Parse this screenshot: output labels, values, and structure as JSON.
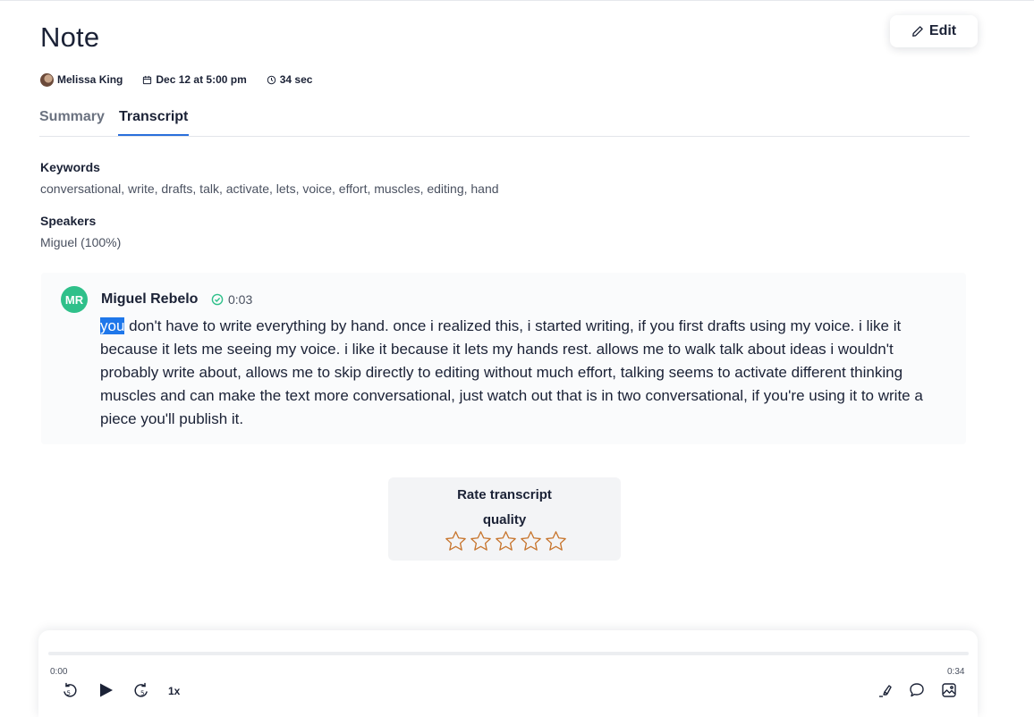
{
  "page": {
    "title": "Note"
  },
  "actions": {
    "edit_label": "Edit"
  },
  "meta": {
    "author": "Melissa King",
    "date": "Dec 12 at 5:00 pm",
    "duration": "34 sec"
  },
  "tabs": [
    {
      "label": "Summary",
      "active": false
    },
    {
      "label": "Transcript",
      "active": true
    }
  ],
  "keywords": {
    "label": "Keywords",
    "value": "conversational, write, drafts, talk, activate, lets, voice, effort, muscles, editing, hand"
  },
  "speakers": {
    "label": "Speakers",
    "value": "Miguel (100%)"
  },
  "transcript": {
    "initials": "MR",
    "speaker": "Miguel Rebelo",
    "timestamp": "0:03",
    "highlight_word": "you",
    "text": " don't have to write everything by hand. once i realized this, i started writing, if you first drafts using my voice. i like it  because it lets me seeing my voice. i like it because it lets my hands rest. allows me to walk talk about ideas i wouldn't probably write about, allows me to skip directly to editing without much effort, talking seems to activate different thinking muscles and can make the text more conversational, just watch out that is in two conversational, if you're using  it to write a piece you'll publish it."
  },
  "rating": {
    "title_line1": "Rate transcript",
    "title_line2": "quality",
    "stars_total": 5,
    "stars_selected": 0,
    "star_color": "#c8762f"
  },
  "player": {
    "current_time": "0:00",
    "total_time": "0:34",
    "progress": 0,
    "speed": "1x"
  },
  "colors": {
    "accent": "#2a6fdb",
    "avatar_bg": "#2fc08a",
    "highlight": "#1e77ea"
  }
}
